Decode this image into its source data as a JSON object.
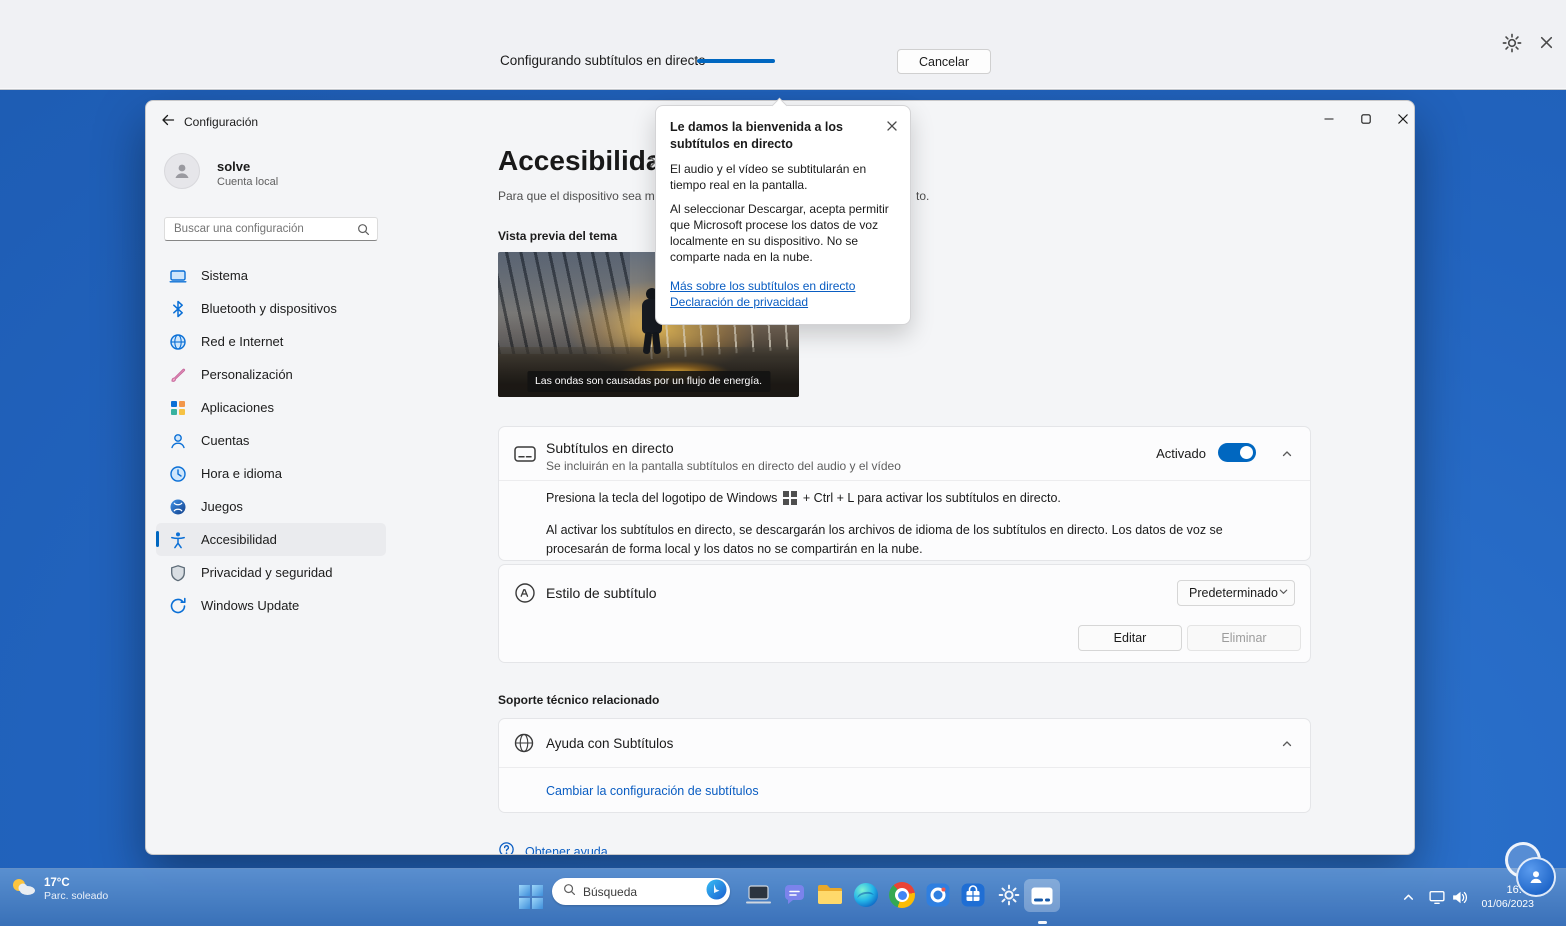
{
  "colors": {
    "accent": "#0067c0",
    "link": "#0a5dc2",
    "desktop_blue": "#2264bf",
    "caption_bar_bg": "#f0f1f4"
  },
  "caption_bar": {
    "status": "Configurando subtítulos en directo",
    "cancel_label": "Cancelar"
  },
  "popup": {
    "title": "Le damos la bienvenida a los subtítulos en directo",
    "body1": "El audio y el vídeo se subtitularán en tiempo real en la pantalla.",
    "body2": "Al seleccionar Descargar, acepta permitir que Microsoft procese los datos de voz localmente en su dispositivo. No se comparte nada en la nube.",
    "link_more": "Más sobre los subtítulos en directo",
    "link_privacy": "Declaración de privacidad"
  },
  "settings": {
    "window_title": "Configuración",
    "user": {
      "name": "solve",
      "account_type": "Cuenta local"
    },
    "search_placeholder": "Buscar una configuración",
    "nav": [
      {
        "label": "Sistema"
      },
      {
        "label": "Bluetooth y dispositivos"
      },
      {
        "label": "Red e Internet"
      },
      {
        "label": "Personalización"
      },
      {
        "label": "Aplicaciones"
      },
      {
        "label": "Cuentas"
      },
      {
        "label": "Hora e idioma"
      },
      {
        "label": "Juegos"
      },
      {
        "label": "Accesibilidad",
        "selected": true
      },
      {
        "label": "Privacidad y seguridad"
      },
      {
        "label": "Windows Update"
      }
    ],
    "page": {
      "title": "Accesibilidad",
      "intro_left": "Para que el dispositivo sea más",
      "intro_right": "to.",
      "preview_label": "Vista previa del tema",
      "preview_caption": "Las ondas son causadas por un flujo de energía.",
      "live_captions": {
        "title": "Subtítulos en directo",
        "subtitle": "Se incluirán en la pantalla subtítulos en directo del audio y el vídeo",
        "state_label": "Activado",
        "shortcut_pre": "Presiona la tecla del logotipo de Windows",
        "shortcut_post": "+ Ctrl + L para activar los subtítulos en directo.",
        "download_note": "Al activar los subtítulos en directo, se descargarán los archivos de idioma de los subtítulos en directo. Los datos de voz se procesarán de forma local y los datos no se compartirán en la nube."
      },
      "caption_style": {
        "label": "Estilo de subtítulo",
        "value": "Predeterminado",
        "edit_label": "Editar",
        "delete_label": "Eliminar"
      },
      "support_header": "Soporte técnico relacionado",
      "help_card_title": "Ayuda con Subtítulos",
      "change_settings_link": "Cambiar la configuración de subtítulos",
      "get_help_link": "Obtener ayuda"
    }
  },
  "taskbar": {
    "weather": {
      "temperature": "17°C",
      "condition": "Parc. soleado"
    },
    "search_label": "Búsqueda",
    "clock": {
      "time": "16:44",
      "date": "01/06/2023"
    }
  }
}
